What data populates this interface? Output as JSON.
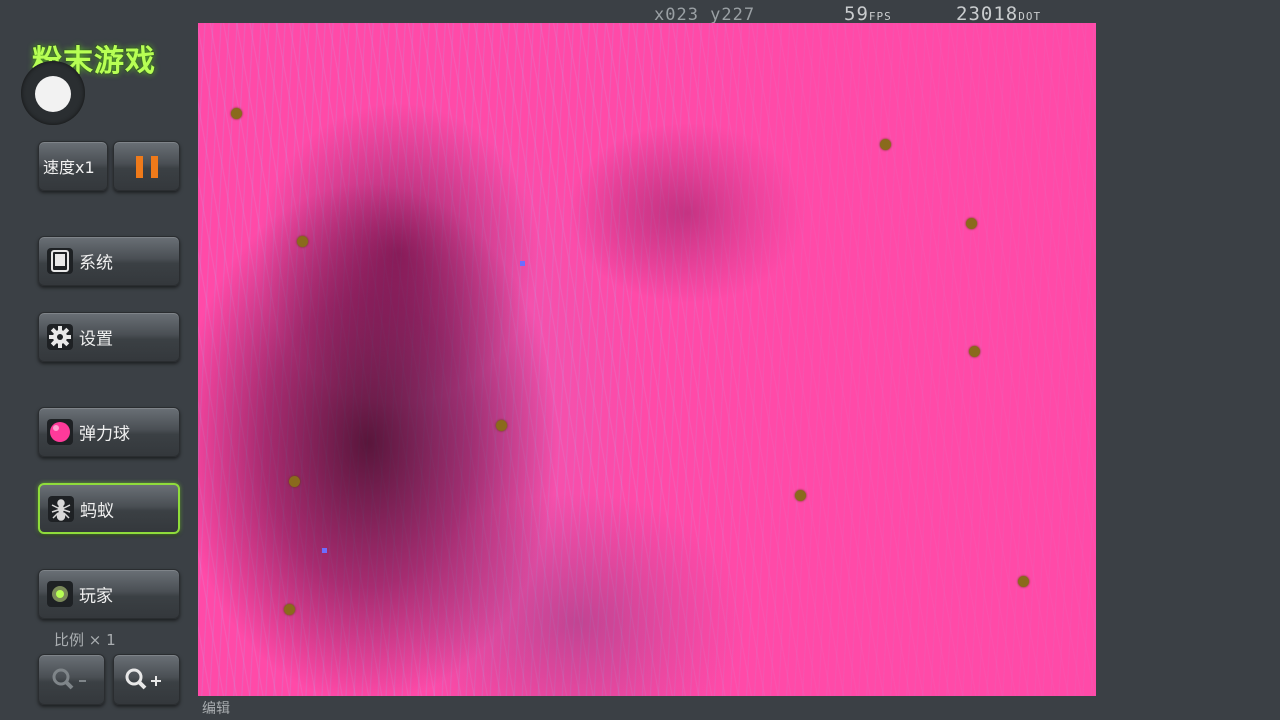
{
  "status": {
    "coord_text": "x023 y227",
    "fps_value": "59",
    "fps_unit": "FPS",
    "dot_value": "23018",
    "dot_unit": "DOT"
  },
  "app": {
    "title": "粉末游戏"
  },
  "toolbar": {
    "speed_label": "速度x1",
    "pause_icon": "pause-icon"
  },
  "menu": {
    "system_label": "系统",
    "settings_label": "设置"
  },
  "tools": {
    "selected": "蚂蚁",
    "items": [
      {
        "label": "弹力球",
        "icon": "pink-ball-icon",
        "active": false
      },
      {
        "label": "蚂蚁",
        "icon": "ant-icon",
        "active": true
      },
      {
        "label": "玩家",
        "icon": "player-icon",
        "active": false
      }
    ]
  },
  "zoom": {
    "scale_label": "比例 × 1",
    "zoom_out_icon": "zoom-out-icon",
    "zoom_in_icon": "zoom-in-icon"
  },
  "bottom": {
    "edit_label": "编辑"
  },
  "colors": {
    "canvas_bg": "#ff4aa8",
    "title_green": "#b7ff54",
    "active_border": "#8fdc3b",
    "ant_color": "#8a6a1c",
    "pause_orange": "#ef7a1a"
  }
}
